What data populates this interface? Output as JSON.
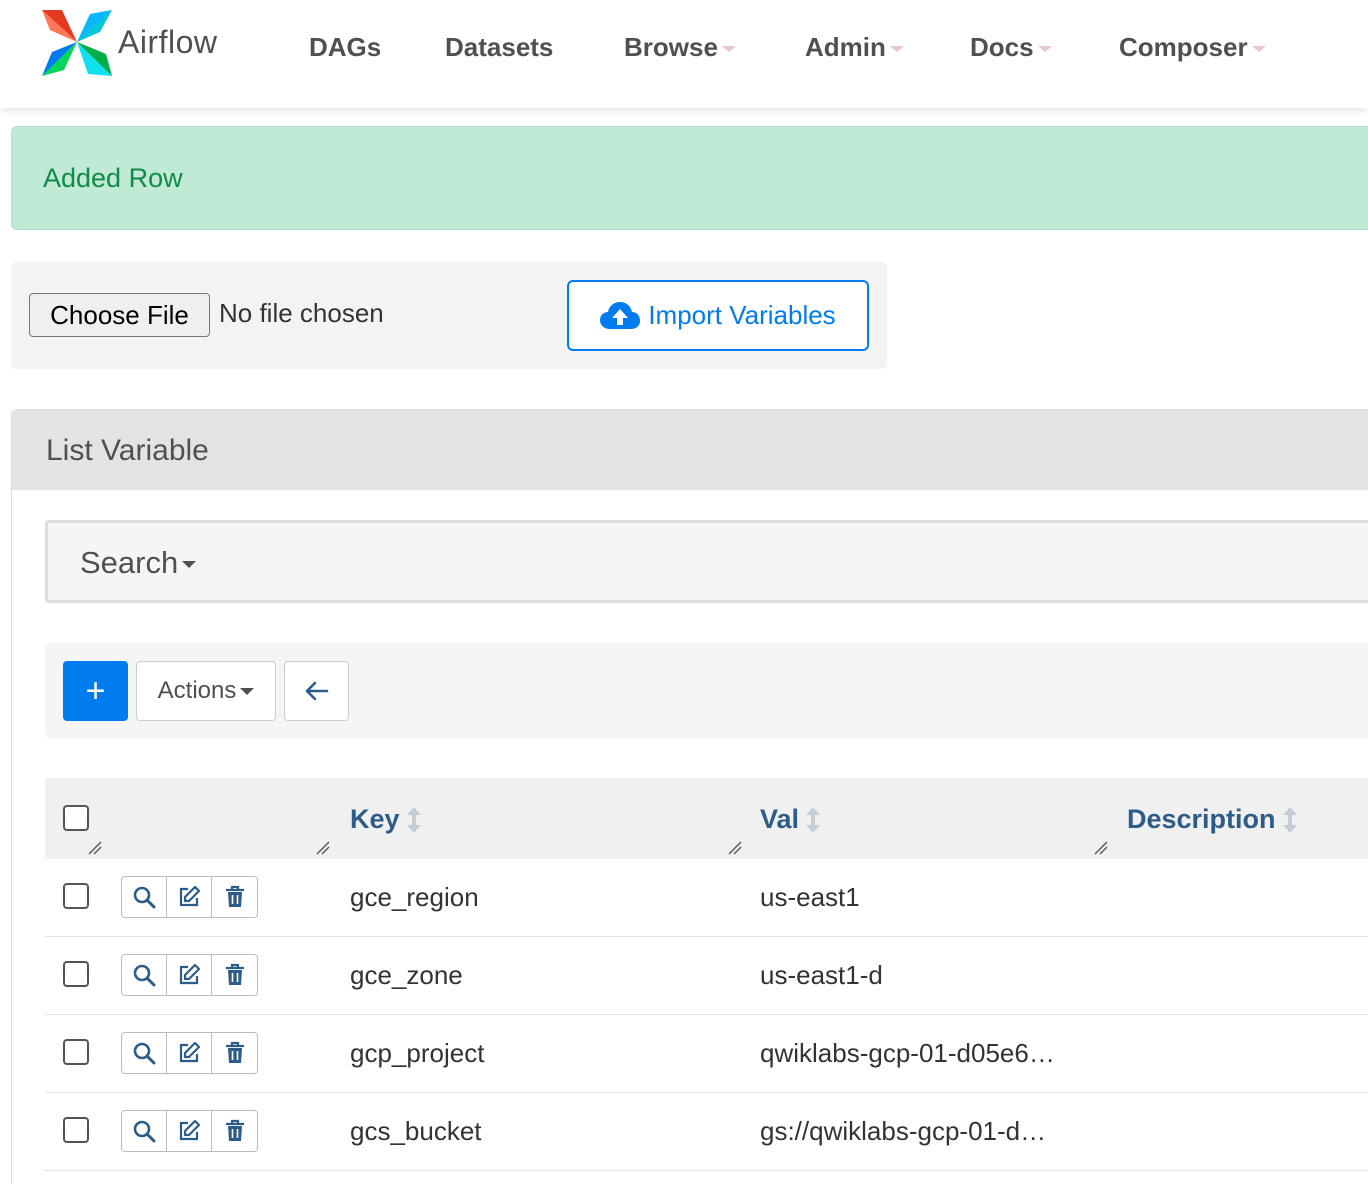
{
  "navbar": {
    "brand": "Airflow",
    "items": [
      {
        "label": "DAGs",
        "dropdown": false
      },
      {
        "label": "Datasets",
        "dropdown": false
      },
      {
        "label": "Browse",
        "dropdown": true
      },
      {
        "label": "Admin",
        "dropdown": true
      },
      {
        "label": "Docs",
        "dropdown": true
      },
      {
        "label": "Composer",
        "dropdown": true
      }
    ]
  },
  "alert": {
    "message": "Added Row"
  },
  "upload": {
    "choose_label": "Choose File",
    "no_file": "No file chosen",
    "import_label": "Import Variables"
  },
  "panel": {
    "title": "List Variable"
  },
  "search": {
    "label": "Search"
  },
  "toolbar": {
    "add_label": "+",
    "actions_label": "Actions"
  },
  "table": {
    "columns": [
      "Key",
      "Val",
      "Description"
    ],
    "rows": [
      {
        "key": "gce_region",
        "val": "us-east1",
        "description": ""
      },
      {
        "key": "gce_zone",
        "val": "us-east1-d",
        "description": ""
      },
      {
        "key": "gcp_project",
        "val": "qwiklabs-gcp-01-d05e6…",
        "description": ""
      },
      {
        "key": "gcs_bucket",
        "val": "gs://qwiklabs-gcp-01-d…",
        "description": ""
      }
    ]
  },
  "colors": {
    "primary": "#017cee",
    "alert_bg": "#c0ead5",
    "alert_text": "#0f8b47",
    "header_link": "#2e5c88"
  }
}
